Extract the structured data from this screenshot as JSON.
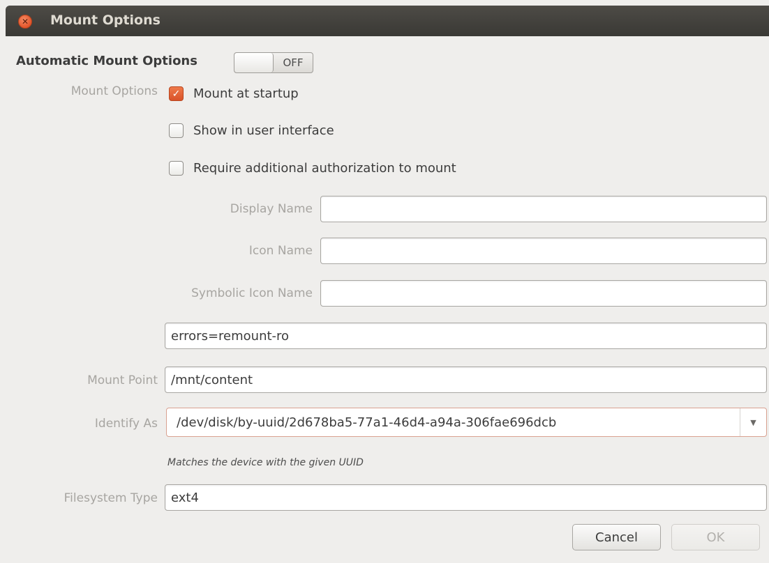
{
  "window": {
    "title": "Mount Options"
  },
  "automatic": {
    "label": "Automatic Mount Options",
    "switch_state": "OFF"
  },
  "mount_options": {
    "label": "Mount Options",
    "checkboxes": [
      {
        "label": "Mount at startup",
        "checked": true
      },
      {
        "label": "Show in user interface",
        "checked": false
      },
      {
        "label": "Require additional authorization to mount",
        "checked": false
      }
    ]
  },
  "fields": {
    "display_name": {
      "label": "Display Name",
      "value": ""
    },
    "icon_name": {
      "label": "Icon Name",
      "value": ""
    },
    "symbolic_icon_name": {
      "label": "Symbolic Icon Name",
      "value": ""
    },
    "options": {
      "value": "errors=remount-ro"
    },
    "mount_point": {
      "label": "Mount Point",
      "value": "/mnt/content"
    },
    "identify_as": {
      "label": "Identify As",
      "value": "/dev/disk/by-uuid/2d678ba5-77a1-46d4-a94a-306fae696dcb",
      "hint": "Matches the device with the given UUID"
    },
    "filesystem_type": {
      "label": "Filesystem Type",
      "value": "ext4"
    }
  },
  "buttons": {
    "cancel": "Cancel",
    "ok": "OK"
  },
  "icons": {
    "close": "close-icon",
    "check": "checkmark-icon",
    "dropdown": "chevron-down-icon"
  },
  "colors": {
    "accent": "#e2552b",
    "titlebar": "#3c3b37",
    "background": "#efeeec"
  }
}
